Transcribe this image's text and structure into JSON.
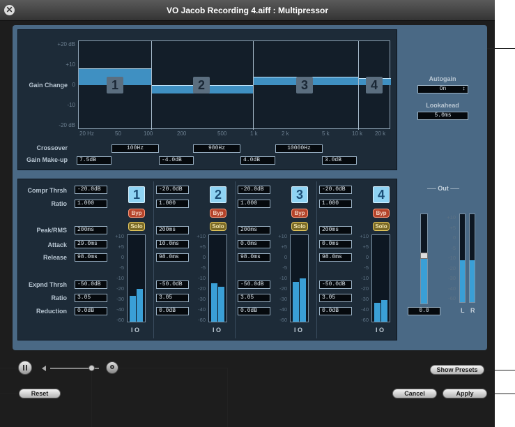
{
  "window": {
    "title": "VO Jacob Recording 4.aiff : Multipressor"
  },
  "graph": {
    "y_label": "Gain Change",
    "y_ticks": [
      "+20 dB",
      "+10",
      "0",
      "-10",
      "-20 dB"
    ],
    "x_ticks": [
      "20 Hz",
      "50",
      "100",
      "200",
      "500",
      "1 k",
      "2 k",
      "5 k",
      "10 k",
      "20 k"
    ],
    "bands": [
      "1",
      "2",
      "3",
      "4"
    ]
  },
  "crossover": {
    "label": "Crossover",
    "values": [
      "100Hz",
      "980Hz",
      "10000Hz"
    ]
  },
  "makeup": {
    "label": "Gain Make-up",
    "values": [
      "7.5dB",
      "-4.0dB",
      "4.0dB",
      "3.0dB"
    ]
  },
  "side": {
    "autogain_label": "Autogain",
    "autogain_value": "On",
    "lookahead_label": "Lookahead",
    "lookahead_value": "5.0ms"
  },
  "rows": {
    "compr_thrsh": "Compr Thrsh",
    "ratio": "Ratio",
    "peak_rms": "Peak/RMS",
    "attack": "Attack",
    "release": "Release",
    "expnd_thrsh": "Expnd Thrsh",
    "ratio2": "Ratio",
    "reduction": "Reduction"
  },
  "band_params": [
    {
      "num": "1",
      "compr": "-20.0dB",
      "ratio": "1.000",
      "peak": "200ms",
      "attack": "29.0ms",
      "release": "98.0ms",
      "expnd": "-50.0dB",
      "eratio": "3.05",
      "reduction": "0.0dB",
      "byp": "Byp",
      "solo": "Solo"
    },
    {
      "num": "2",
      "compr": "-20.0dB",
      "ratio": "1.000",
      "peak": "200ms",
      "attack": "10.0ms",
      "release": "98.0ms",
      "expnd": "-50.0dB",
      "eratio": "3.05",
      "reduction": "0.0dB",
      "byp": "Byp",
      "solo": "Solo"
    },
    {
      "num": "3",
      "compr": "-20.0dB",
      "ratio": "1.000",
      "peak": "200ms",
      "attack": "0.0ms",
      "release": "98.0ms",
      "expnd": "-50.0dB",
      "eratio": "3.05",
      "reduction": "0.0dB",
      "byp": "Byp",
      "solo": "Solo"
    },
    {
      "num": "4",
      "compr": "-20.0dB",
      "ratio": "1.000",
      "peak": "200ms",
      "attack": "0.0ms",
      "release": "98.0ms",
      "expnd": "-50.0dB",
      "eratio": "3.05",
      "reduction": "0.0dB",
      "byp": "Byp",
      "solo": "Solo"
    }
  ],
  "meter_scale": [
    "+10",
    "+5",
    "0",
    "-5",
    "-10",
    "-20",
    "-30",
    "-40",
    "-60"
  ],
  "io_label": "I O",
  "output": {
    "title": "Out",
    "value": "0.0",
    "left": "L",
    "right": "R"
  },
  "buttons": {
    "show_presets": "Show Presets",
    "reset": "Reset",
    "cancel": "Cancel",
    "apply": "Apply"
  },
  "colors": {
    "panel": "#4a6985",
    "meter": "#3a9fd6",
    "band": "#3f90c2"
  }
}
